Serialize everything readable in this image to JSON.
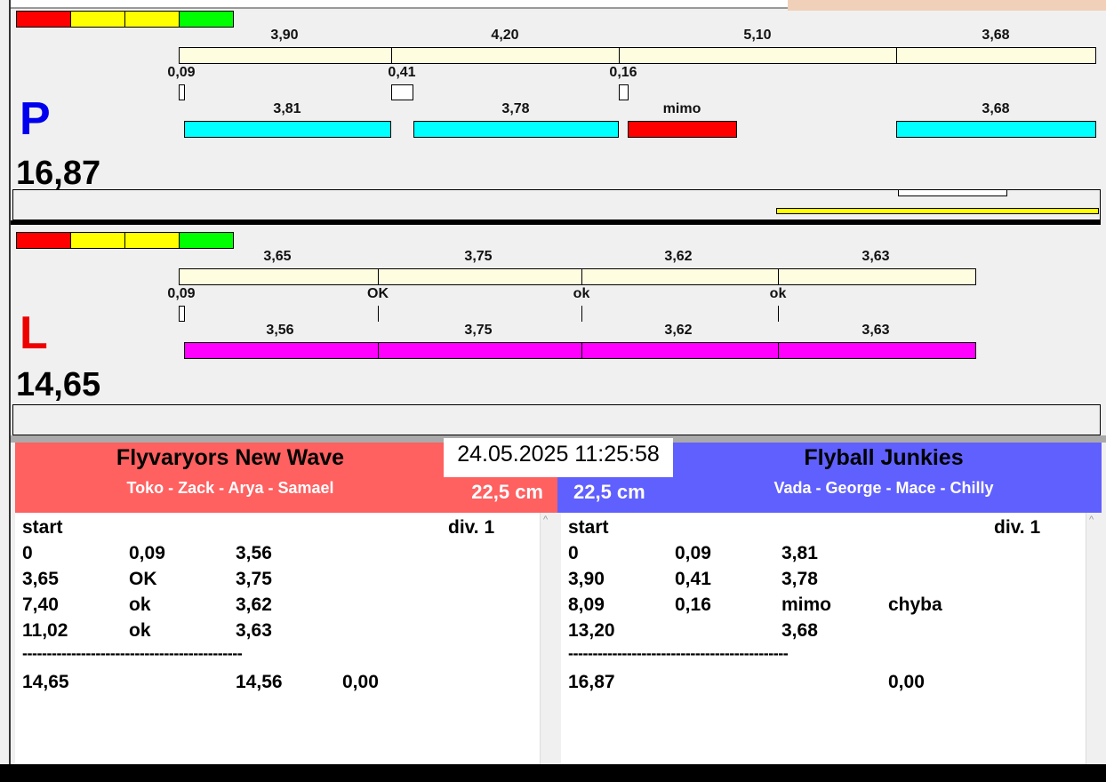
{
  "lanes": {
    "P": {
      "letter": "P",
      "color": "#0000ee",
      "total": "16,87",
      "splits": [
        "3,90",
        "4,20",
        "5,10",
        "3,68"
      ],
      "starts": [
        "0,09",
        "0,41",
        "0,16"
      ],
      "runs": [
        "3,81",
        "3,78",
        "mimo",
        "3,68"
      ]
    },
    "L": {
      "letter": "L",
      "color": "#ee0000",
      "total": "14,65",
      "splits": [
        "3,65",
        "3,75",
        "3,62",
        "3,63"
      ],
      "starts": [
        "0,09",
        "OK",
        "ok",
        "ok"
      ],
      "runs": [
        "3,56",
        "3,75",
        "3,62",
        "3,63"
      ]
    }
  },
  "colors": {
    "pending": "#fffde0",
    "run_right": "#00ffff",
    "run_left": "#ff00ff",
    "fault": "#ff0000",
    "team_left": "#ff6060",
    "team_right": "#6060ff"
  },
  "datetime": "24.05.2025 11:25:58",
  "teams": {
    "left": {
      "name": "Flyvaryors New Wave",
      "dogs": "Toko - Zack - Arya - Samael",
      "height": "22,5 cm"
    },
    "right": {
      "name": "Flyball Junkies",
      "dogs": "Vada - George - Mace - Chilly",
      "height": "22,5 cm"
    }
  },
  "log": {
    "left": {
      "start": "start",
      "division": "div.  1",
      "rows": [
        [
          "0",
          "0,09",
          "3,56",
          ""
        ],
        [
          "3,65",
          "OK",
          "3,75",
          ""
        ],
        [
          "7,40",
          "ok",
          "3,62",
          ""
        ],
        [
          "11,02",
          "ok",
          "3,63",
          ""
        ]
      ],
      "separator": "---------------------------------------------",
      "total": [
        "14,65",
        "",
        "14,56",
        "0,00"
      ]
    },
    "right": {
      "start": "start",
      "division": "div.  1",
      "rows": [
        [
          "0",
          "0,09",
          "3,81",
          ""
        ],
        [
          "3,90",
          "0,41",
          "3,78",
          ""
        ],
        [
          "8,09",
          "0,16",
          "mimo",
          "chyba"
        ],
        [
          "13,20",
          "",
          "3,68",
          ""
        ]
      ],
      "separator": "---------------------------------------------",
      "total": [
        "16,87",
        "",
        "",
        "0,00"
      ]
    }
  }
}
